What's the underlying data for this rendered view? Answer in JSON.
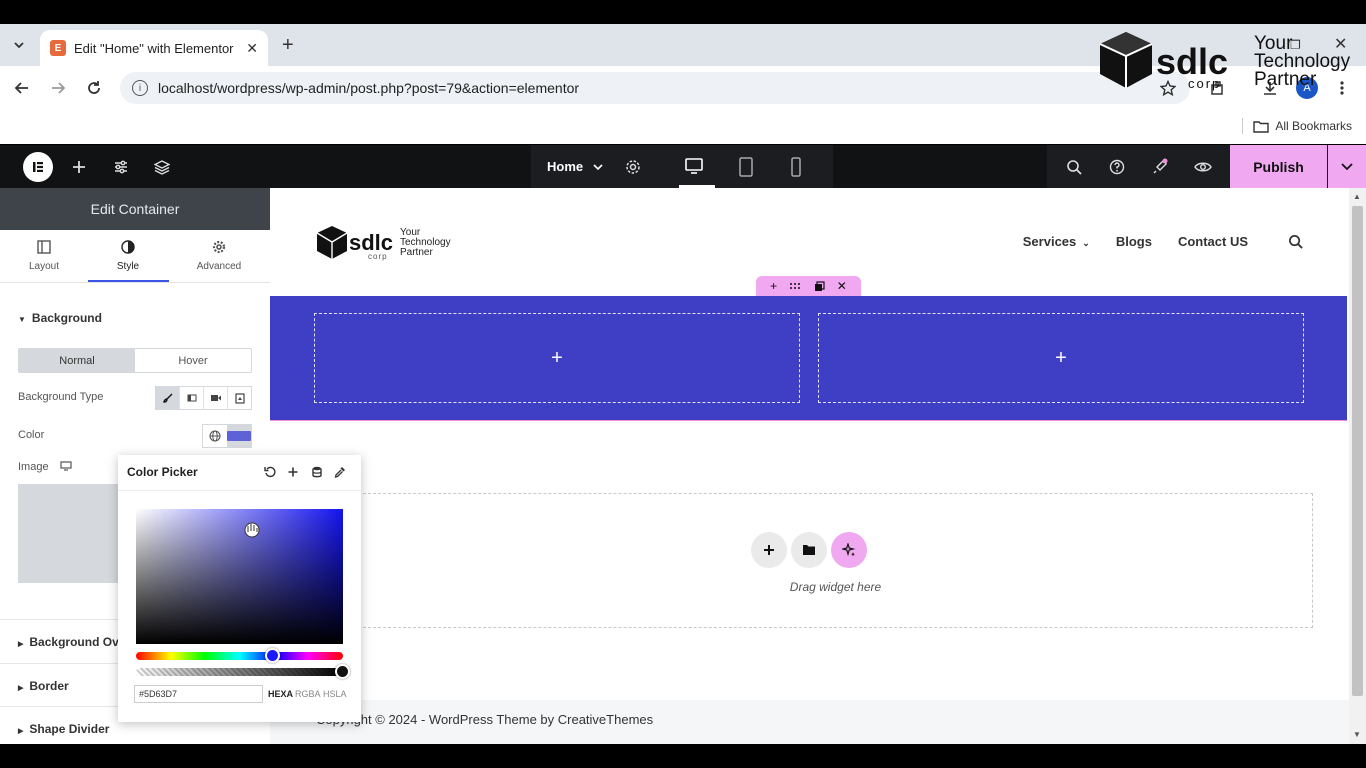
{
  "browser": {
    "tab_title": "Edit \"Home\" with Elementor",
    "tab_close": "✕",
    "new_tab": "+",
    "url": "localhost/wordpress/wp-admin/post.php?post=79&action=elementor",
    "profile_initial": "A",
    "all_bookmarks": "All Bookmarks"
  },
  "watermark": {
    "line1": "Your",
    "line2": "Technology",
    "line3": "Partner"
  },
  "elementor_bar": {
    "page_name": "Home",
    "publish_label": "Publish"
  },
  "panel": {
    "header": "Edit Container",
    "tabs": [
      {
        "label": "Layout",
        "icon": "layout-icon"
      },
      {
        "label": "Style",
        "icon": "style-icon"
      },
      {
        "label": "Advanced",
        "icon": "gear-icon"
      }
    ],
    "active_tab": "Style",
    "background_section": "Background",
    "normal_label": "Normal",
    "hover_label": "Hover",
    "bg_type_label": "Background Type",
    "color_label": "Color",
    "image_label": "Image",
    "collapsed_sections": [
      "Background Overlay",
      "Border",
      "Shape Divider"
    ],
    "selected_color": "#5D63D7"
  },
  "site": {
    "logo_text_1": "Your",
    "logo_text_2": "Technology",
    "logo_text_3": "Partner",
    "logo_sub": "corp",
    "nav": {
      "services": "Services",
      "blogs": "Blogs",
      "contact": "Contact US"
    },
    "section_bg": "#3f3fc6",
    "col_plus": "+",
    "drag_text": "Drag widget here",
    "copyright": "Copyright © 2024 - WordPress Theme by CreativeThemes"
  },
  "color_picker": {
    "title": "Color Picker",
    "hex_value": "#5D63D7",
    "formats": [
      "HEXA",
      "RGBA",
      "HSLA"
    ],
    "active_format": "HEXA",
    "hue_color": "#1a1aff"
  },
  "colors": {
    "accent_pink": "#f0a8f0",
    "elementor_dark": "#101214",
    "tab_underline": "#3b55e6"
  }
}
